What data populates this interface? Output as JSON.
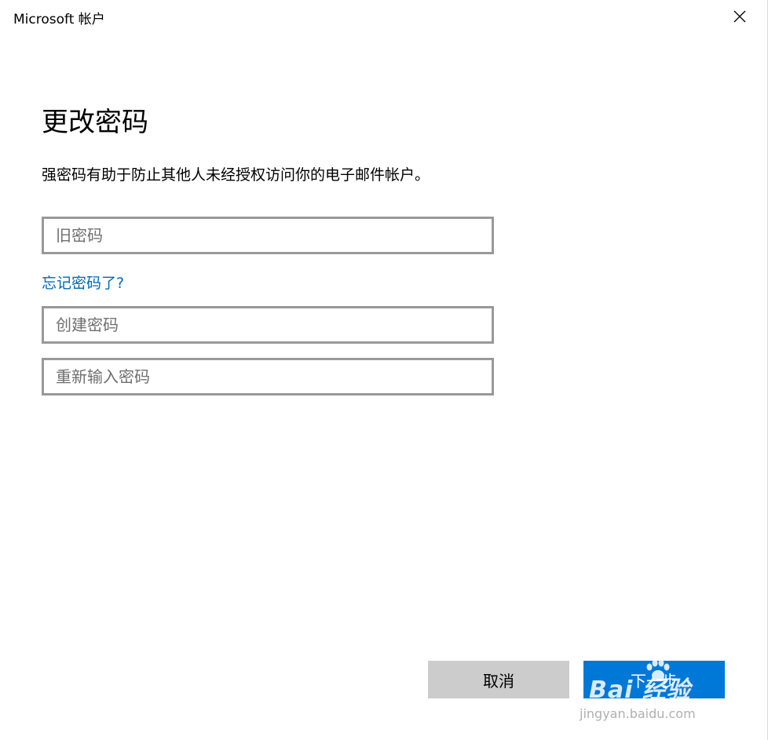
{
  "window": {
    "title": "Microsoft 帐户",
    "close_icon": "close-icon"
  },
  "page": {
    "heading": "更改密码",
    "description": "强密码有助于防止其他人未经授权访问你的电子邮件帐户。"
  },
  "form": {
    "old_password": {
      "placeholder": "旧密码",
      "value": ""
    },
    "forgot_link": "忘记密码了?",
    "new_password": {
      "placeholder": "创建密码",
      "value": ""
    },
    "confirm_password": {
      "placeholder": "重新输入密码",
      "value": ""
    }
  },
  "buttons": {
    "cancel": "取消",
    "next": "下一步"
  },
  "watermark": {
    "brand": "Bai  经验",
    "site": "jingyan.baidu.com"
  },
  "colors": {
    "accent": "#0078d7",
    "link": "#0067b8",
    "cancel_bg": "#cccccc",
    "field_border": "#999999"
  }
}
